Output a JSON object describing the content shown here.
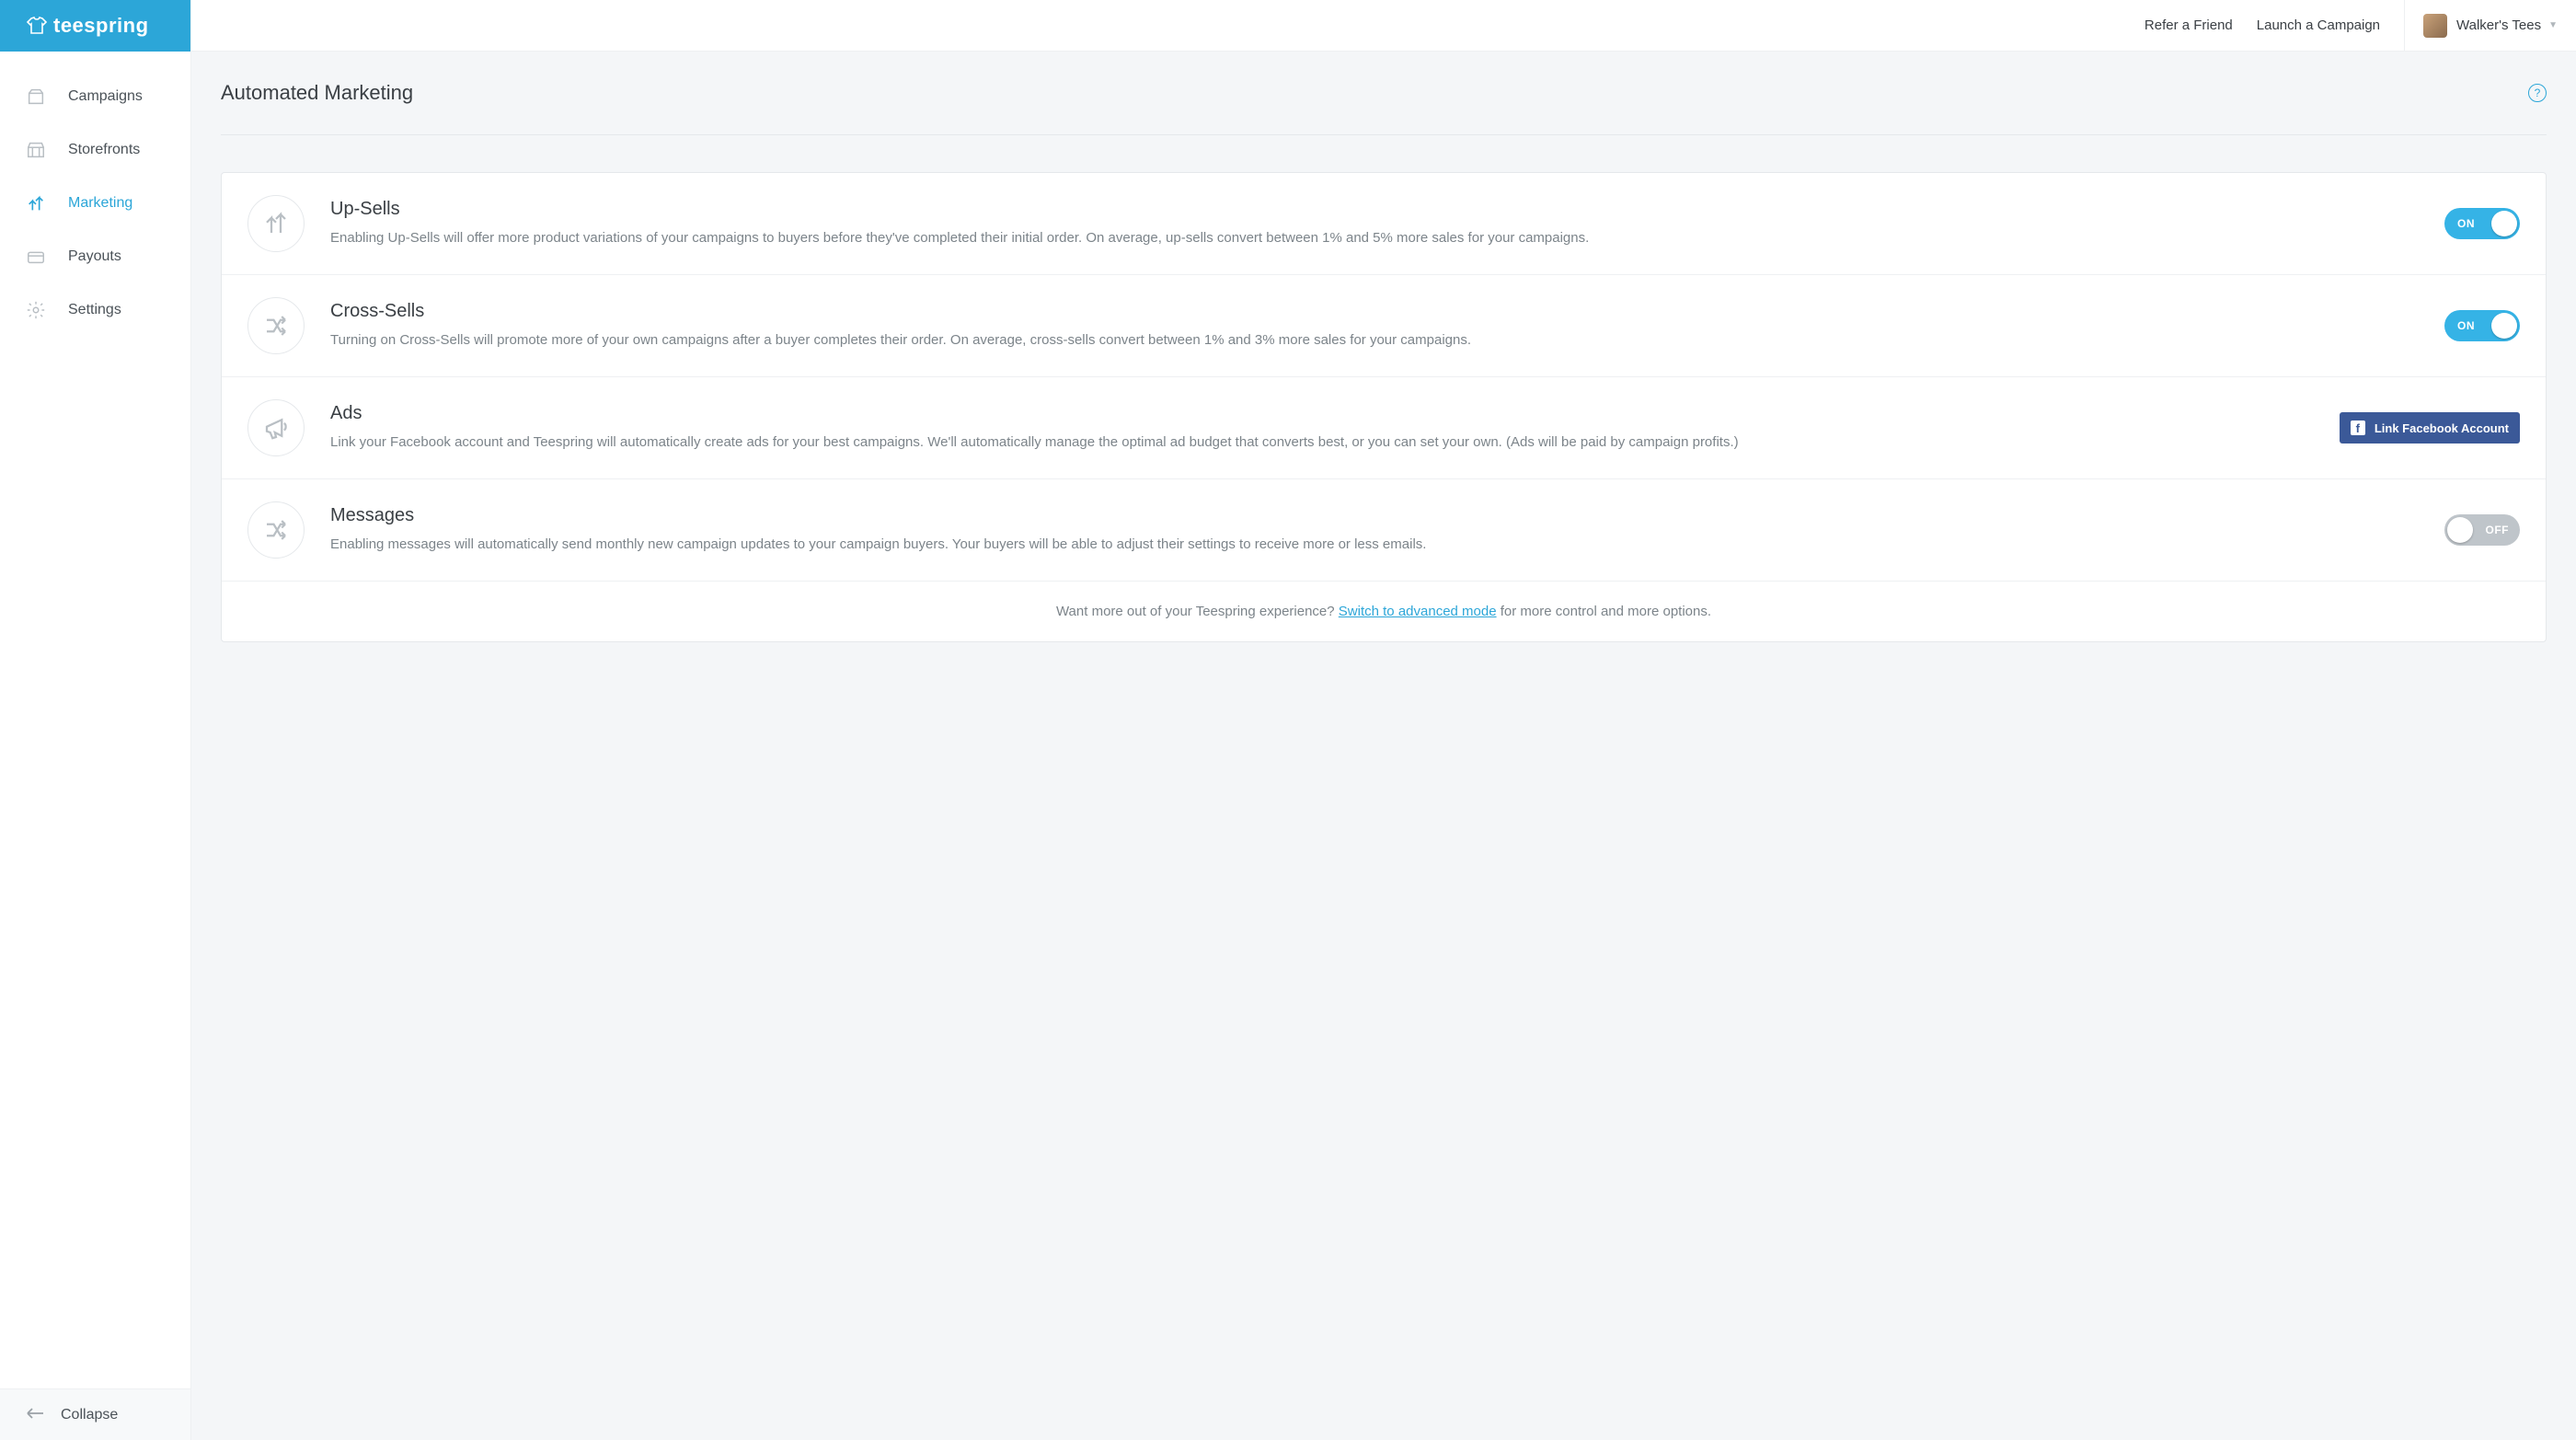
{
  "brand": "teespring",
  "header": {
    "refer": "Refer a Friend",
    "launch": "Launch a Campaign",
    "username": "Walker's Tees"
  },
  "sidebar": {
    "items": [
      {
        "label": "Campaigns"
      },
      {
        "label": "Storefronts"
      },
      {
        "label": "Marketing"
      },
      {
        "label": "Payouts"
      },
      {
        "label": "Settings"
      }
    ],
    "collapse": "Collapse"
  },
  "page": {
    "title": "Automated Marketing"
  },
  "toggle_labels": {
    "on": "ON",
    "off": "OFF"
  },
  "rows": {
    "upsells": {
      "title": "Up-Sells",
      "desc": "Enabling Up-Sells will offer more product variations of your campaigns to buyers before they've completed their initial order. On average, up-sells convert between 1% and 5% more sales for your campaigns.",
      "state": "on"
    },
    "crosssells": {
      "title": "Cross-Sells",
      "desc": "Turning on Cross-Sells will promote more of your own campaigns after a buyer completes their order. On average, cross-sells convert between 1% and 3% more sales for your campaigns.",
      "state": "on"
    },
    "ads": {
      "title": "Ads",
      "desc": "Link your Facebook account and Teespring will automatically create ads for your best campaigns. We'll automatically manage the optimal ad budget that converts best, or you can set your own. (Ads will be paid by campaign profits.)",
      "button": "Link Facebook Account"
    },
    "messages": {
      "title": "Messages",
      "desc": "Enabling messages will automatically send monthly new campaign updates to your campaign buyers. Your buyers will be able to adjust their settings to receive more or less emails.",
      "state": "off"
    }
  },
  "footer": {
    "pre": "Want more out of your Teespring experience? ",
    "link": "Switch to advanced mode",
    "post": " for more control and more options."
  }
}
